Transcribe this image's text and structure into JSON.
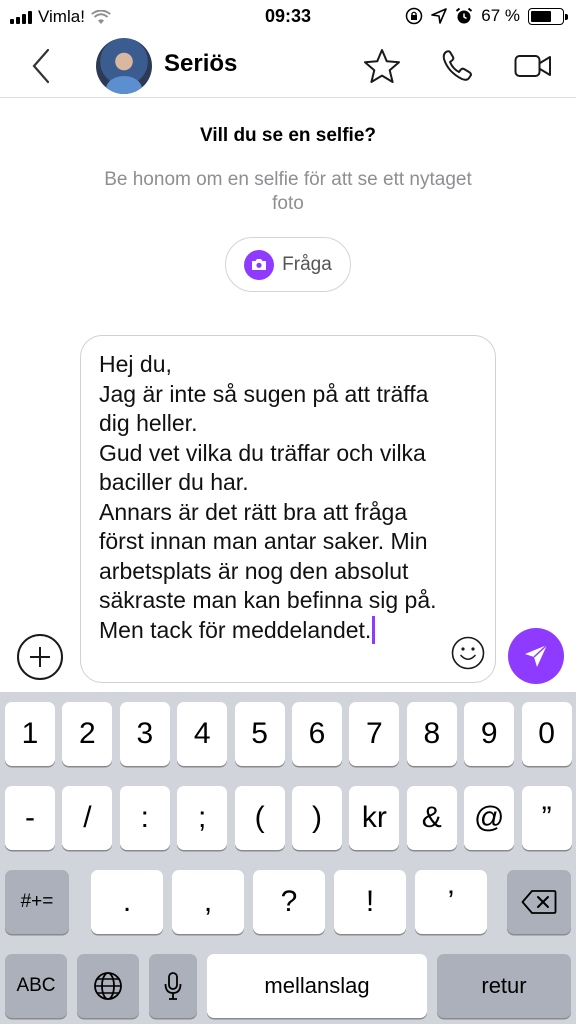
{
  "status_bar": {
    "carrier": "Vimla!",
    "time": "09:33",
    "battery": "67 %",
    "battery_level": 0.67
  },
  "header": {
    "contact_name": "Seriös"
  },
  "selfie_prompt": {
    "title": "Vill du se en selfie?",
    "subtitle": "Be honom om en selfie för att se ett nytaget foto",
    "ask_label": "Fråga"
  },
  "composer": {
    "text": "Hej du,\nJag är inte så sugen på att träffa dig heller.\nGud vet vilka du träffar och vilka baciller du har.\nAnnars är det rätt bra att fråga först innan man antar saker. Min arbetsplats är nog den absolut säkraste man kan befinna sig på.\nMen tack för meddelandet."
  },
  "colors": {
    "accent": "#8e3bff",
    "keyboard_bg": "#d1d4da",
    "key_dark": "#abb0ba"
  },
  "keyboard": {
    "row1": [
      "1",
      "2",
      "3",
      "4",
      "5",
      "6",
      "7",
      "8",
      "9",
      "0"
    ],
    "row2": [
      "-",
      "/",
      ":",
      ";",
      "(",
      ")",
      "kr",
      "&",
      "@",
      "”"
    ],
    "row3": {
      "mode": "#+=",
      "keys": [
        ".",
        ",",
        "?",
        "!",
        "’"
      ],
      "delete_icon": "backspace-icon"
    },
    "row4": {
      "abc": "ABC",
      "globe_icon": "globe-icon",
      "mic_icon": "microphone-icon",
      "space": "mellanslag",
      "return": "retur"
    }
  }
}
